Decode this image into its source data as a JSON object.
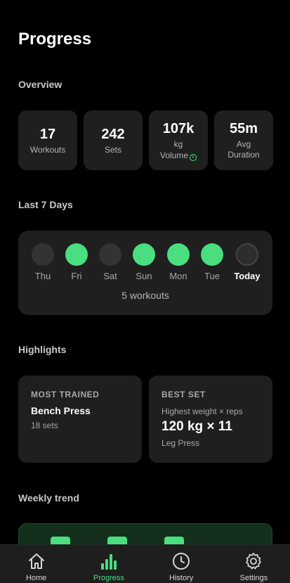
{
  "page": {
    "title": "Progress"
  },
  "overview": {
    "title": "Overview",
    "stats": [
      {
        "value": "17",
        "label": "Workouts"
      },
      {
        "value": "242",
        "label": "Sets"
      },
      {
        "value": "107k",
        "label_line1": "kg",
        "label_line2": "Volume"
      },
      {
        "value": "55m",
        "label_line1": "Avg",
        "label_line2": "Duration"
      }
    ]
  },
  "last7": {
    "title": "Last 7 Days",
    "days": [
      {
        "label": "Thu",
        "done": false
      },
      {
        "label": "Fri",
        "done": true
      },
      {
        "label": "Sat",
        "done": false
      },
      {
        "label": "Sun",
        "done": true
      },
      {
        "label": "Mon",
        "done": true
      },
      {
        "label": "Tue",
        "done": true
      },
      {
        "label": "Today",
        "done": false
      }
    ],
    "summary": "5 workouts"
  },
  "highlights": {
    "title": "Highlights",
    "most_trained": {
      "kicker": "MOST TRAINED",
      "name": "Bench Press",
      "detail": "18 sets"
    },
    "best_set": {
      "kicker": "BEST SET",
      "caption": "Highest weight × reps",
      "value": "120 kg × 11",
      "exercise": "Leg Press"
    }
  },
  "weekly_trend": {
    "title": "Weekly trend"
  },
  "nav": {
    "items": [
      {
        "label": "Home",
        "icon": "home-icon",
        "active": false
      },
      {
        "label": "Progress",
        "icon": "bar-chart-icon",
        "active": true
      },
      {
        "label": "History",
        "icon": "clock-icon",
        "active": false
      },
      {
        "label": "Settings",
        "icon": "gear-icon",
        "active": false
      }
    ]
  },
  "colors": {
    "accent": "#4ade80",
    "card": "#1f1f1f",
    "background": "#000000"
  }
}
